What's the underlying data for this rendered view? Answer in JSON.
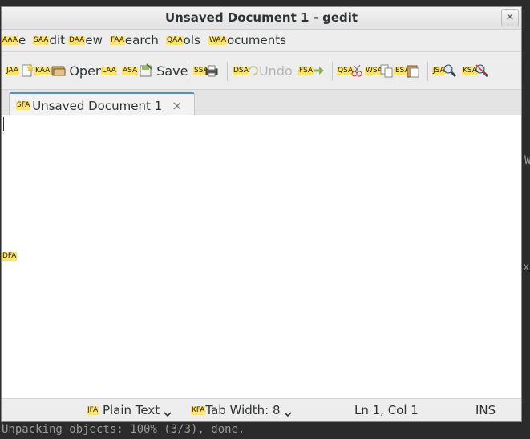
{
  "background_terminal": {
    "bottom_line": "Unpacking objects: 100% (3/3), done.",
    "right_fragment_1": "W",
    "right_fragment_2": "xt"
  },
  "window": {
    "title": "Unsaved Document 1 - gedit",
    "close_glyph": "×"
  },
  "menubar": [
    {
      "hint": "AAA",
      "label": "e"
    },
    {
      "hint": "SAA",
      "label": "dit"
    },
    {
      "hint": "DAA",
      "label": "ew"
    },
    {
      "hint": "FAA",
      "label": "earch"
    },
    {
      "hint": "QAA",
      "label": "ols"
    },
    {
      "hint": "WAA",
      "label": "ocuments"
    }
  ],
  "toolbar": {
    "new_hint": "JAA",
    "open_hint": "KAA",
    "open_label": "Open",
    "recent_hint": "LAA",
    "save_hint": "ASA",
    "save_label": "Save",
    "print_hint": "SSA",
    "undo_hint": "DSA",
    "undo_label": "Undo",
    "redo_hint": "FSA",
    "cut_hint": "QSA",
    "copy_hint": "WSA",
    "paste_hint": "ESA",
    "find_hint": "JSA",
    "replace_hint": "KSA"
  },
  "tab": {
    "hint": "SFA",
    "label": "Unsaved Document 1",
    "close_glyph": "×"
  },
  "editor": {
    "side_hint": "DFA"
  },
  "statusbar": {
    "language_hint": "JFA",
    "language": "Plain Text",
    "tabwidth_hint": "KFA",
    "tabwidth_label": "Tab Width:",
    "tabwidth_value": "8",
    "position": "Ln 1, Col 1",
    "mode": "INS"
  },
  "colors": {
    "hint_bg": "#ffe566",
    "tab_accent": "#4a90d9"
  }
}
